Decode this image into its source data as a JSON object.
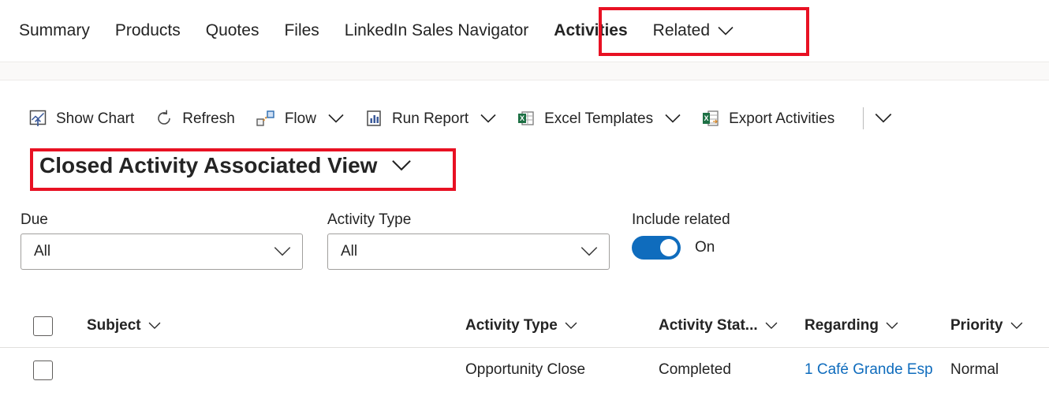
{
  "nav": {
    "items": [
      {
        "label": "Summary",
        "selected": false
      },
      {
        "label": "Products",
        "selected": false
      },
      {
        "label": "Quotes",
        "selected": false
      },
      {
        "label": "Files",
        "selected": false
      },
      {
        "label": "LinkedIn Sales Navigator",
        "selected": false
      },
      {
        "label": "Activities",
        "selected": true
      }
    ],
    "related_label": "Related",
    "caret_icon": "chevron-down-icon"
  },
  "command_bar": {
    "items": [
      {
        "label": "Show Chart",
        "icon": "show-chart-icon",
        "caret": false
      },
      {
        "label": "Refresh",
        "icon": "refresh-icon",
        "caret": false
      },
      {
        "label": "Flow",
        "icon": "flow-icon",
        "caret": true
      },
      {
        "label": "Run Report",
        "icon": "run-report-icon",
        "caret": true
      },
      {
        "label": "Excel Templates",
        "icon": "excel-templates-icon",
        "caret": true
      },
      {
        "label": "Export Activities",
        "icon": "export-excel-icon",
        "caret": false
      }
    ],
    "overflow_icon": "chevron-down-icon"
  },
  "view_selector": {
    "title": "Closed Activity Associated View",
    "caret_icon": "chevron-down-icon"
  },
  "filters": {
    "due": {
      "label": "Due",
      "value": "All",
      "caret_icon": "chevron-down-icon"
    },
    "activity_type": {
      "label": "Activity Type",
      "value": "All",
      "caret_icon": "chevron-down-icon"
    },
    "include_related": {
      "label": "Include related",
      "state": "On"
    }
  },
  "grid": {
    "columns": [
      {
        "label": "Subject",
        "caret_icon": "chevron-down-icon"
      },
      {
        "label": "Activity Type",
        "caret_icon": "chevron-down-icon"
      },
      {
        "label": "Activity Stat...",
        "caret_icon": "chevron-down-icon"
      },
      {
        "label": "Regarding",
        "caret_icon": "chevron-down-icon"
      },
      {
        "label": "Priority",
        "caret_icon": "chevron-down-icon"
      }
    ],
    "rows": [
      {
        "subject": "",
        "activity_type": "Opportunity Close",
        "activity_status": "Completed",
        "regarding": "1 Café Grande Esp",
        "priority": "Normal"
      }
    ]
  },
  "colors": {
    "accent": "#0f6cbd",
    "highlight": "#e81123",
    "text": "#242424"
  }
}
